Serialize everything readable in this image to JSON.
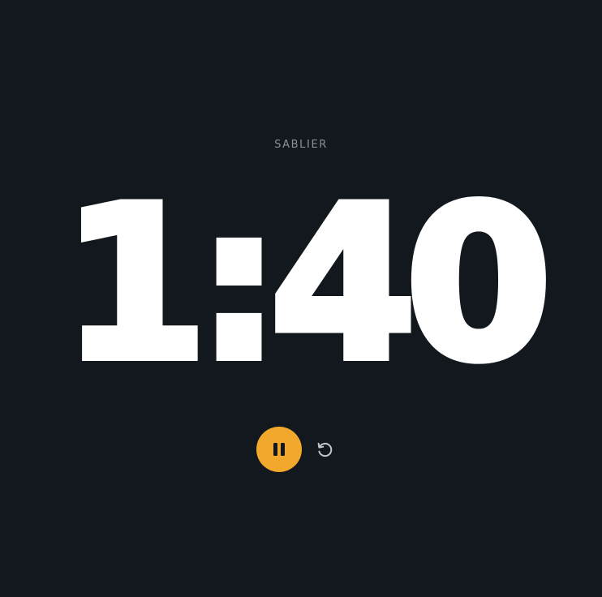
{
  "timer": {
    "label": "SABLIER",
    "display": "1:40",
    "state": "running"
  },
  "controls": {
    "pause_icon": "pause-icon",
    "reset_icon": "reset-icon"
  },
  "colors": {
    "background": "#12181d",
    "accent": "#f1a82c",
    "text": "#ffffff",
    "muted": "#8b9196"
  }
}
